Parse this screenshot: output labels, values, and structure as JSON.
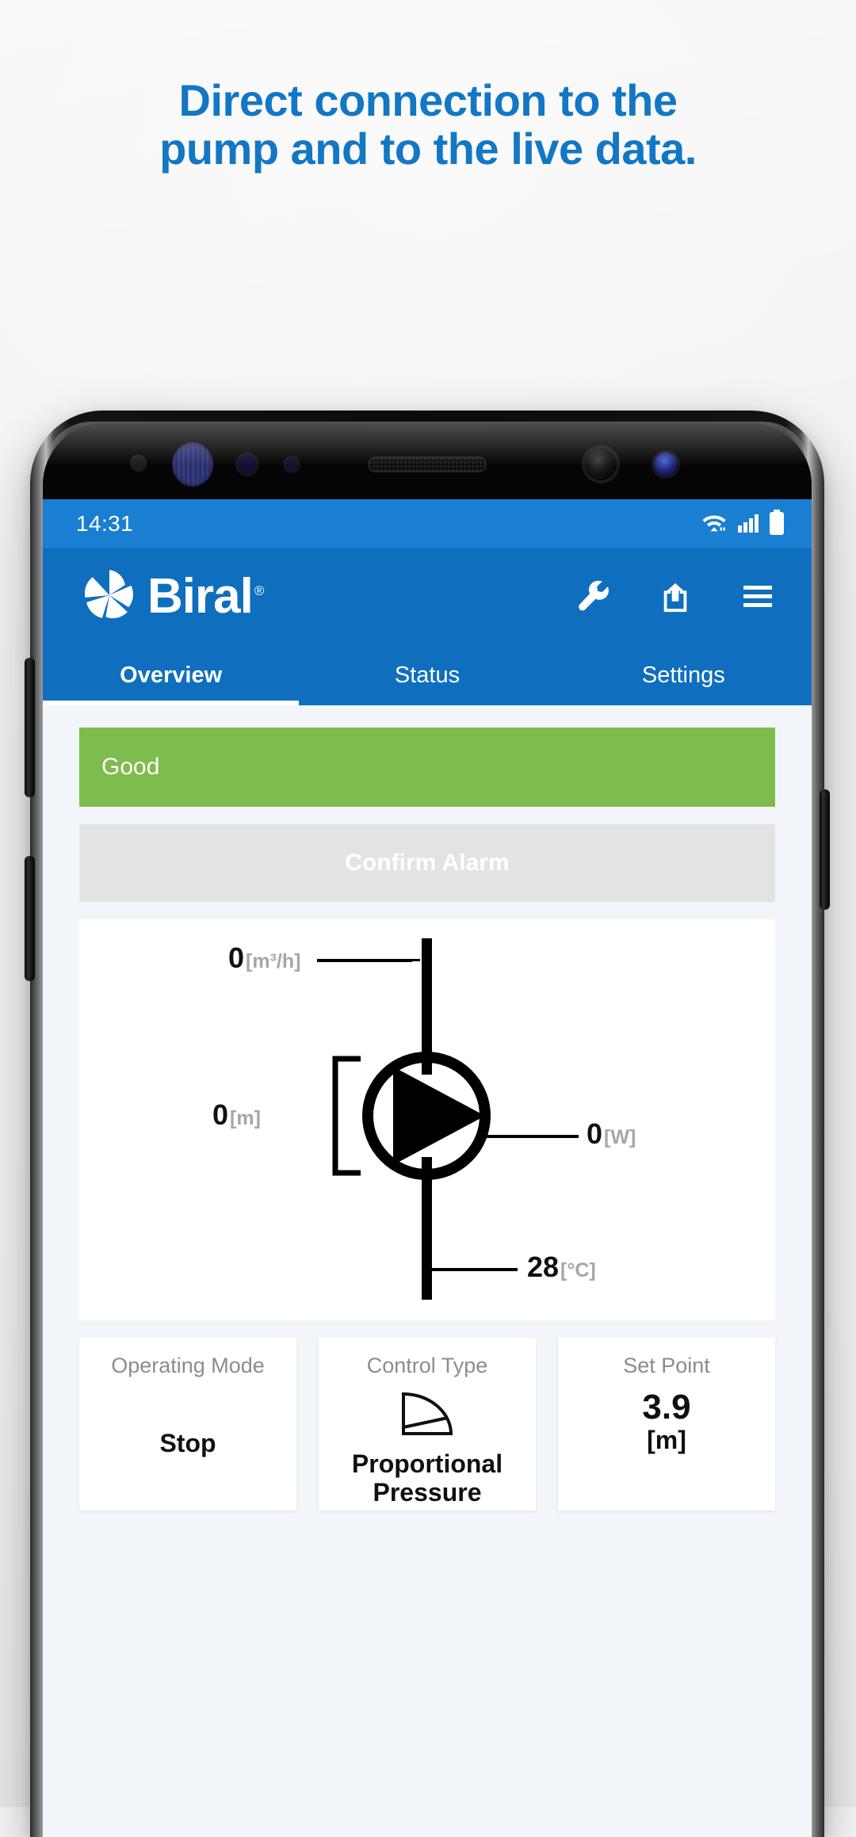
{
  "promo": {
    "headline_line1": "Direct connection to the",
    "headline_line2": "pump and to the live data.",
    "headline_color": "#1277c4"
  },
  "device": {
    "statusbar": {
      "time": "14:31",
      "icons": [
        "wifi-icon",
        "cellular-signal-icon",
        "battery-icon"
      ]
    }
  },
  "app": {
    "brand": {
      "name": "Biral",
      "registered_mark": "®",
      "logo_icon": "biral-impeller-logo-icon",
      "bar_color": "#0f6fbe"
    },
    "actions": [
      {
        "name": "wrench-icon",
        "label": "Service"
      },
      {
        "name": "share-icon",
        "label": "Share"
      },
      {
        "name": "hamburger-menu-icon",
        "label": "Menu"
      }
    ],
    "tabs": [
      {
        "label": "Overview",
        "active": true
      },
      {
        "label": "Status",
        "active": false
      },
      {
        "label": "Settings",
        "active": false
      }
    ],
    "status_banner": {
      "text": "Good",
      "color": "#7dbc4d"
    },
    "confirm_alarm": {
      "label": "Confirm Alarm",
      "disabled": true,
      "bg_color": "#e3e3e3"
    },
    "pump_diagram": {
      "flow": {
        "value": "0",
        "unit": "[m³/h]"
      },
      "head": {
        "value": "0",
        "unit": "[m]"
      },
      "power": {
        "value": "0",
        "unit": "[W]"
      },
      "temperature": {
        "value": "28",
        "unit": "[°C]"
      }
    },
    "cards": [
      {
        "title": "Operating Mode",
        "value": "Stop",
        "unit": "",
        "icon": ""
      },
      {
        "title": "Control Type",
        "value": "Proportional Pressure",
        "unit": "",
        "icon": "proportional-pressure-curve-icon"
      },
      {
        "title": "Set Point",
        "value": "3.9",
        "unit": "[m]",
        "icon": ""
      }
    ]
  }
}
